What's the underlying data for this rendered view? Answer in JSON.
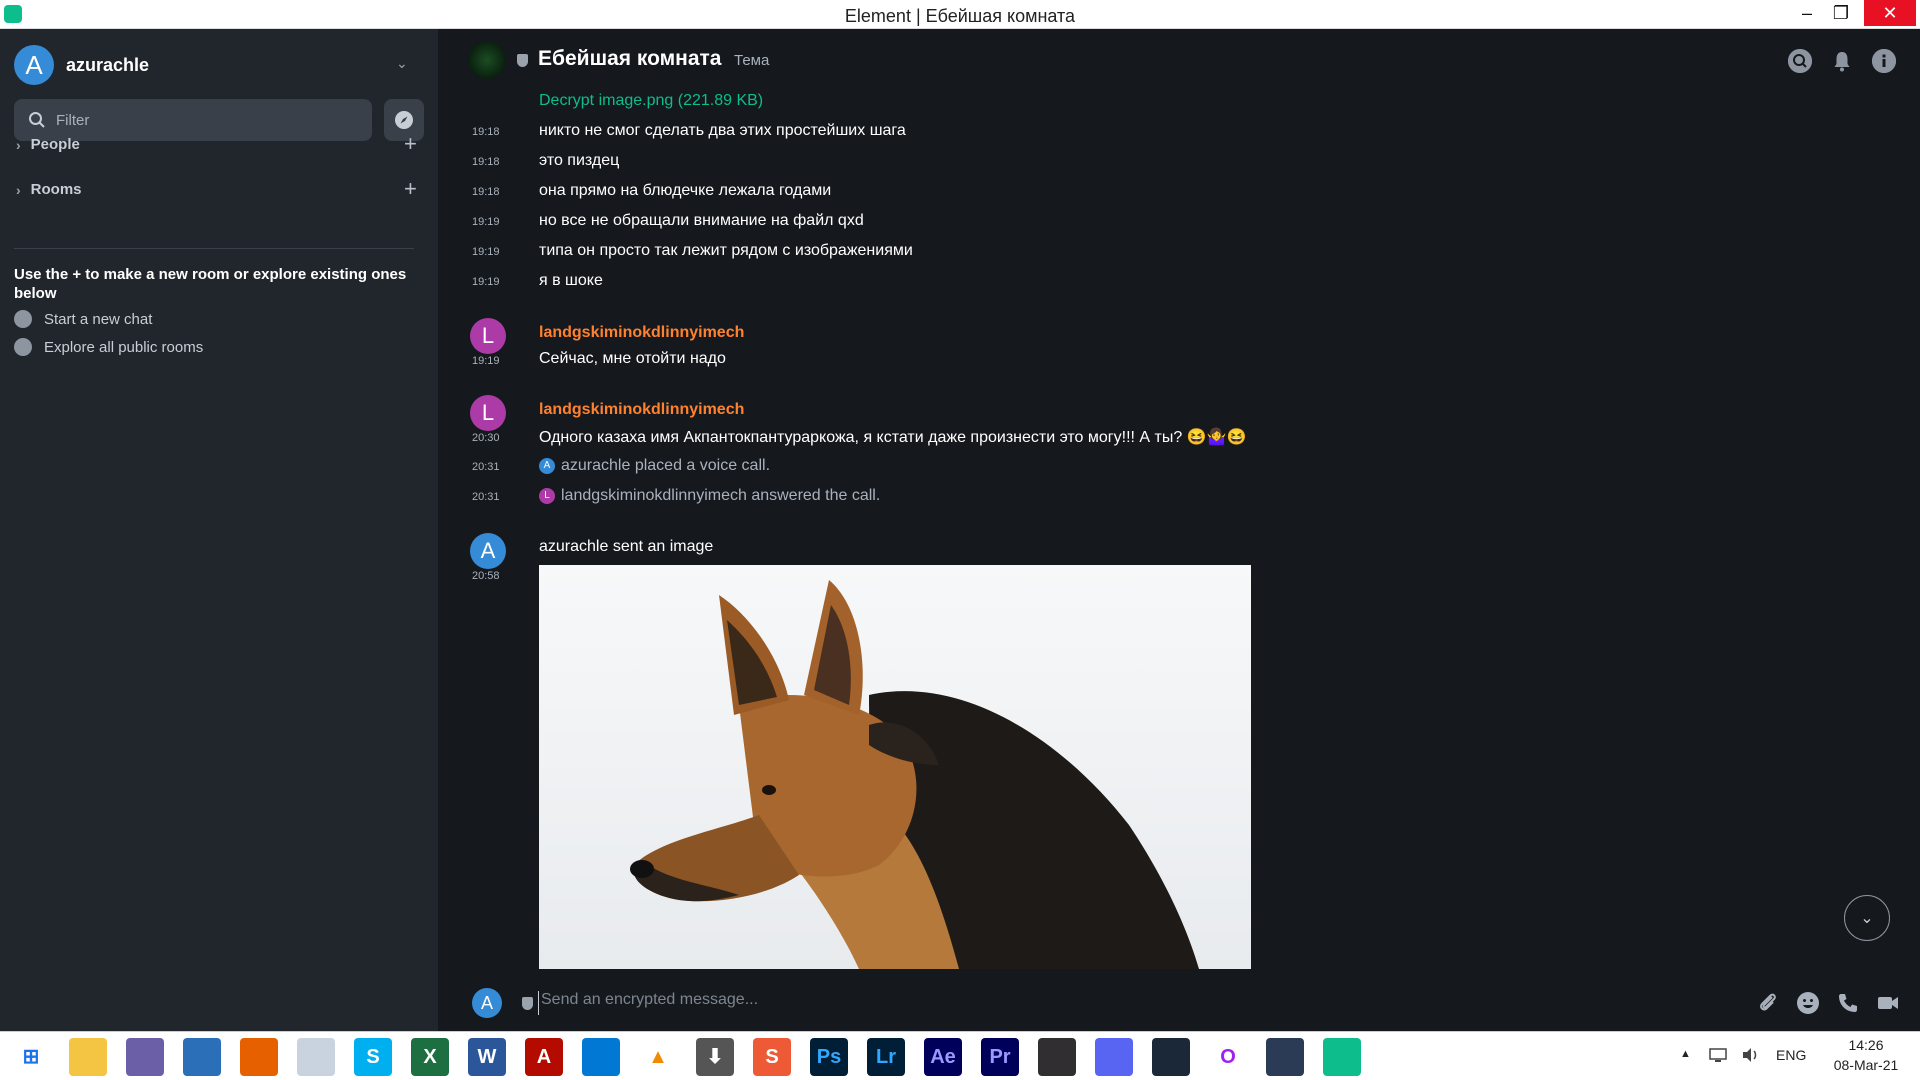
{
  "window": {
    "title": "Element | Ебейшая комната",
    "minimize_glyph": "–",
    "maximize_glyph": "❐",
    "close_glyph": "✕"
  },
  "sidebar": {
    "account": {
      "initial": "A",
      "name": "azurachle",
      "chevron": "⌄"
    },
    "filter_placeholder": "Filter",
    "sections": [
      {
        "label": "People",
        "chevron": "›",
        "add": "+"
      },
      {
        "label": "Rooms",
        "chevron": "›",
        "add": "+"
      }
    ],
    "hint": "Use the + to make a new room or explore existing ones below",
    "links": [
      {
        "label": "Start a new chat",
        "icon": "chat-bubble-icon"
      },
      {
        "label": "Explore all public rooms",
        "icon": "compass-icon"
      }
    ]
  },
  "room": {
    "name": "Ебейшая комната",
    "topic": "Тема",
    "header_icons": [
      "search-icon",
      "bell-icon",
      "info-icon"
    ]
  },
  "timeline": {
    "file_link": "Decrypt image.png (221.89 KB)",
    "messages": [
      {
        "ts": "19:18",
        "text": "никто не смог сделать два этих простейших шага"
      },
      {
        "ts": "19:18",
        "text": "это пиздец"
      },
      {
        "ts": "19:18",
        "text": "она прямо на блюдечке лежала годами"
      },
      {
        "ts": "19:19",
        "text": "но все не обращали внимание на файл qxd"
      },
      {
        "ts": "19:19",
        "text": "типа он просто так лежит рядом с изображениями"
      },
      {
        "ts": "19:19",
        "text": "я в шоке"
      }
    ],
    "group1": {
      "initial": "L",
      "sender": "landgskiminokdlinnyimech",
      "ts": "19:19",
      "text": "Сейчас, мне отойти надо"
    },
    "group2": {
      "initial": "L",
      "sender": "landgskiminokdlinnyimech",
      "ts": "20:30",
      "text": "Одного казаха имя Акпантокпантураркожа, я кстати даже произнести это могу!!! А ты? 😆🤷‍♀️😆"
    },
    "events": [
      {
        "ts": "20:31",
        "initial": "A",
        "text": "azurachle placed a voice call."
      },
      {
        "ts": "20:31",
        "initial": "L",
        "text": "landgskiminokdlinnyimech answered the call."
      }
    ],
    "group3": {
      "initial": "A",
      "ts": "20:58",
      "text": "azurachle sent an image"
    },
    "scroll_glyph": "⌄"
  },
  "composer": {
    "initial": "A",
    "placeholder": "Send an encrypted message...",
    "icons": [
      "paperclip-icon",
      "emoji-icon",
      "phone-icon",
      "video-icon"
    ]
  },
  "taskbar": {
    "apps": [
      {
        "name": "start-icon",
        "label": "⊞",
        "color": "#ffffff",
        "fg": "#1a73e8"
      },
      {
        "name": "file-explorer-icon",
        "label": "",
        "color": "#f4c542",
        "fg": "#fff"
      },
      {
        "name": "bittorrent-icon",
        "label": "",
        "color": "#6b5fa8",
        "fg": "#fff"
      },
      {
        "name": "globe-app-icon",
        "label": "",
        "color": "#2a6fb8",
        "fg": "#fff"
      },
      {
        "name": "firefox-icon",
        "label": "",
        "color": "#e66000",
        "fg": "#fff"
      },
      {
        "name": "moon-app-icon",
        "label": "",
        "color": "#c9d3e0",
        "fg": "#fff"
      },
      {
        "name": "skype-icon",
        "label": "S",
        "color": "#00aff0",
        "fg": "#fff"
      },
      {
        "name": "excel-icon",
        "label": "X",
        "color": "#1d6f42",
        "fg": "#fff"
      },
      {
        "name": "word-icon",
        "label": "W",
        "color": "#2b579a",
        "fg": "#fff"
      },
      {
        "name": "acrobat-icon",
        "label": "A",
        "color": "#b30b00",
        "fg": "#fff"
      },
      {
        "name": "vscode-icon",
        "label": "",
        "color": "#0078d4",
        "fg": "#fff"
      },
      {
        "name": "vlc-icon",
        "label": "▲",
        "color": "#ffffff",
        "fg": "#f08a00"
      },
      {
        "name": "downloader-icon",
        "label": "⬇",
        "color": "#555555",
        "fg": "#fff"
      },
      {
        "name": "sublime-icon",
        "label": "S",
        "color": "#ef5a36",
        "fg": "#fff"
      },
      {
        "name": "photoshop-icon",
        "label": "Ps",
        "color": "#001e36",
        "fg": "#31a8ff"
      },
      {
        "name": "lightroom-icon",
        "label": "Lr",
        "color": "#001e36",
        "fg": "#31a8ff"
      },
      {
        "name": "after-effects-icon",
        "label": "Ae",
        "color": "#00005b",
        "fg": "#9999ff"
      },
      {
        "name": "premiere-icon",
        "label": "Pr",
        "color": "#00005b",
        "fg": "#9999ff"
      },
      {
        "name": "obs-icon",
        "label": "",
        "color": "#302e31",
        "fg": "#fff"
      },
      {
        "name": "discord-icon",
        "label": "",
        "color": "#5865f2",
        "fg": "#fff"
      },
      {
        "name": "steam-icon",
        "label": "",
        "color": "#1b2838",
        "fg": "#fff"
      },
      {
        "name": "opera-icon",
        "label": "O",
        "color": "#ffffff",
        "fg": "#a020f0"
      },
      {
        "name": "vpn-icon",
        "label": "",
        "color": "#2b3a55",
        "fg": "#fff"
      },
      {
        "name": "element-icon",
        "label": "",
        "color": "#0dbd8b",
        "fg": "#fff"
      }
    ],
    "tray": {
      "up_arrow": "▲",
      "language": "ENG",
      "time": "14:26",
      "date": "08-Mar-21"
    }
  }
}
